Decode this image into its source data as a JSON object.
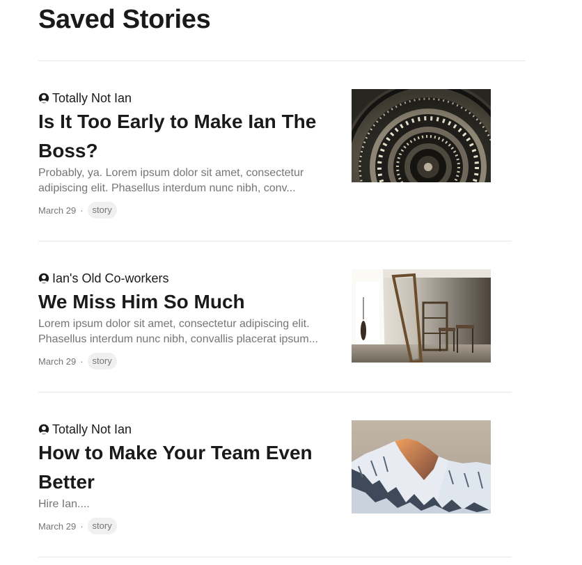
{
  "page": {
    "title": "Saved Stories"
  },
  "stories": [
    {
      "author": "Totally Not Ian",
      "title": "Is It Too Early to Make Ian The Boss?",
      "excerpt": "Probably, ya. Lorem ipsum dolor sit amet, consectetur adipiscing elit. Phasellus interdum nunc nibh, conv...",
      "date": "March 29",
      "separator": "·",
      "tag": "story",
      "image_icon": "spiral-staircase-image"
    },
    {
      "author": "Ian's Old Co-workers",
      "title": "We Miss Him So Much",
      "excerpt": "Lorem ipsum dolor sit amet, consectetur adipiscing elit. Phasellus interdum nunc nibh, convallis placerat ipsum...",
      "date": "March 29",
      "separator": "·",
      "tag": "story",
      "image_icon": "empty-room-image"
    },
    {
      "author": "Totally Not Ian",
      "title": "How to Make Your Team Even Better",
      "excerpt": "Hire Ian....",
      "date": "March 29",
      "separator": "·",
      "tag": "story",
      "image_icon": "snowy-mountain-image"
    }
  ],
  "colors": {
    "text": "#1a1a1a",
    "muted": "#757575",
    "divider": "#e6e6e6",
    "tag_bg": "#f0f0f0"
  }
}
